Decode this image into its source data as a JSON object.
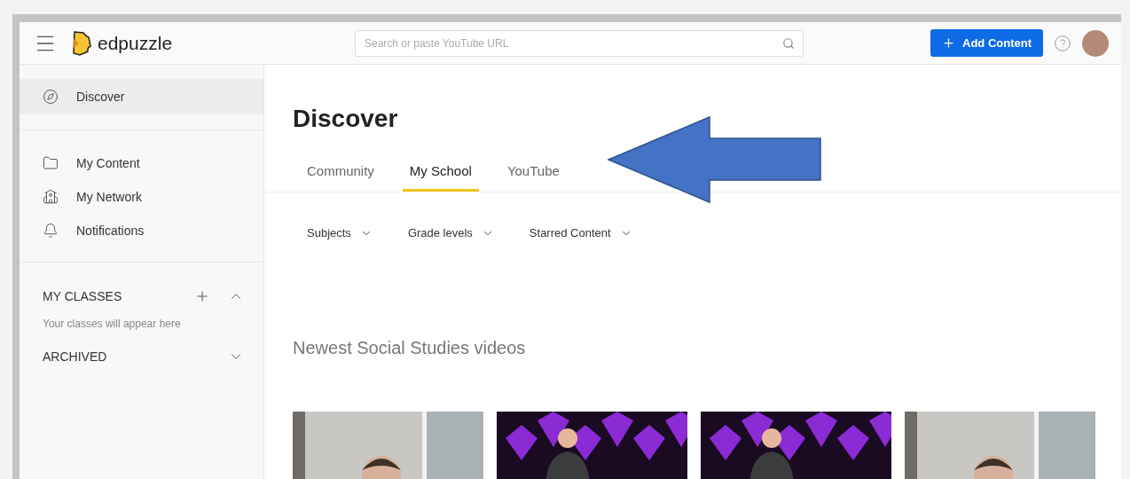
{
  "header": {
    "logo_text": "edpuzzle",
    "search": {
      "placeholder": "Search or paste YouTube URL"
    },
    "add_button": "Add Content"
  },
  "sidebar": {
    "items": [
      {
        "label": "Discover",
        "kind": "compass",
        "selected": true
      },
      {
        "label": "My Content",
        "kind": "folder",
        "selected": false
      },
      {
        "label": "My Network",
        "kind": "network",
        "selected": false
      },
      {
        "label": "Notifications",
        "kind": "bell",
        "selected": false
      }
    ],
    "classes": {
      "title": "MY CLASSES",
      "expanded": true,
      "empty_text": "Your classes will appear here"
    },
    "archived": {
      "title": "ARCHIVED",
      "expanded": false
    }
  },
  "main": {
    "title": "Discover",
    "tabs": [
      {
        "label": "Community",
        "selected": false
      },
      {
        "label": "My School",
        "selected": true
      },
      {
        "label": "YouTube",
        "selected": false
      }
    ],
    "filters": [
      "Subjects",
      "Grade levels",
      "Starred Content"
    ],
    "section_title": "Newest Social Studies videos",
    "videos": [
      {
        "kind": "office"
      },
      {
        "kind": "stage"
      },
      {
        "kind": "stage"
      },
      {
        "kind": "office"
      }
    ]
  },
  "annotations": [
    {
      "kind": "arrow"
    }
  ]
}
